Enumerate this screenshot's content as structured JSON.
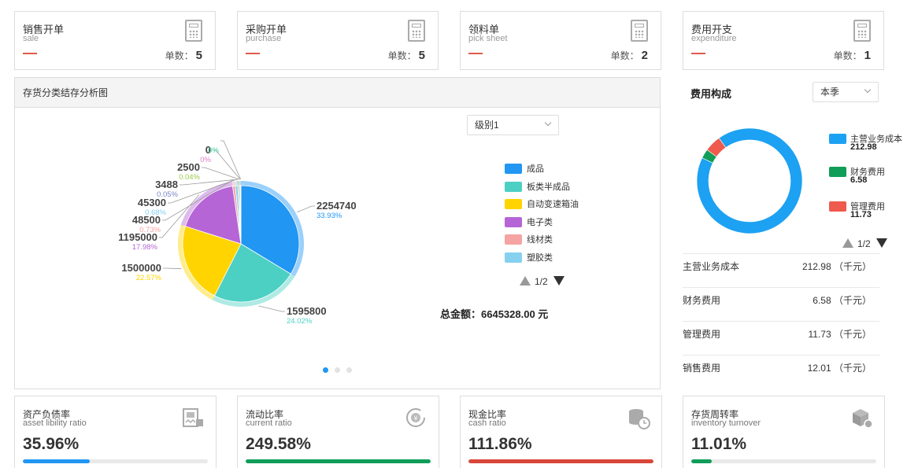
{
  "stat_cards": [
    {
      "title": "销售开单",
      "subtitle": "sale",
      "count_label": "单数：",
      "count": "5"
    },
    {
      "title": "采购开单",
      "subtitle": "purchase",
      "count_label": "单数：",
      "count": "5"
    },
    {
      "title": "领料单",
      "subtitle": "pick sheet",
      "count_label": "单数：",
      "count": "2"
    },
    {
      "title": "费用开支",
      "subtitle": "expenditure",
      "count_label": "单数：",
      "count": "1"
    }
  ],
  "inventory_panel": {
    "title": "存货分类结存分析图",
    "level_select": "级别1",
    "legend": [
      "成品",
      "板类半成品",
      "自动变速箱油",
      "电子类",
      "线材类",
      "塑胶类"
    ],
    "pager": "1/2",
    "total": "总金额：6645328.00 元",
    "page_dots": 3,
    "active_dot": 0
  },
  "chart_data": {
    "type": "pie",
    "title": "存货分类结存分析图",
    "slices": [
      {
        "label": "成品",
        "value": 2254740,
        "percent": "33.93%",
        "color": "#2196f3"
      },
      {
        "label": "板类半成品",
        "value": 1595800,
        "percent": "24.02%",
        "color": "#4dd0c4"
      },
      {
        "label": "自动变速箱油",
        "value": 1500000,
        "percent": "22.57%",
        "color": "#ffd400"
      },
      {
        "label": "电子类",
        "value": 1195000,
        "percent": "17.98%",
        "color": "#b565d6"
      },
      {
        "label": "线材类",
        "value": 48500,
        "percent": "0.73%",
        "color": "#f5a3a3"
      },
      {
        "label": "塑胶类",
        "value": 45300,
        "percent": "0.68%",
        "color": "#86d0f0"
      },
      {
        "label": "",
        "value": 3488,
        "percent": "0.05%",
        "color": "#7a86c8"
      },
      {
        "label": "",
        "value": 2500,
        "percent": "0.04%",
        "color": "#9ccc4e"
      },
      {
        "label": "",
        "value": 0,
        "percent": "0%",
        "color": "#e07bc8"
      },
      {
        "label": "",
        "value": 0,
        "percent": "0%",
        "color": "#42d4a0"
      }
    ]
  },
  "cost_panel": {
    "title": "费用构成",
    "period_select": "本季",
    "pager": "1/2",
    "donut": [
      {
        "name": "主营业务成本",
        "value": 212.98,
        "color": "#1da1f2"
      },
      {
        "name": "财务费用",
        "value": 6.58,
        "color": "#0f9d58"
      },
      {
        "name": "管理费用",
        "value": 11.73,
        "color": "#ee5a4d"
      }
    ],
    "legend_values": [
      "212.98",
      "6.58",
      "11.73"
    ],
    "rows": [
      {
        "name": "主营业务成本",
        "value": "212.98 （千元）"
      },
      {
        "name": "财务费用",
        "value": "6.58 （千元）"
      },
      {
        "name": "管理费用",
        "value": "11.73 （千元）"
      },
      {
        "name": "销售费用",
        "value": "12.01 （千元）"
      }
    ]
  },
  "ratio_cards": [
    {
      "title": "资产负债率",
      "subtitle": "asset libility ratio",
      "value": "35.96%",
      "fraction": 0.3596,
      "color": "#2196f3",
      "icon": "report-icon"
    },
    {
      "title": "流动比率",
      "subtitle": "current ratio",
      "value": "249.58%",
      "fraction": 1.0,
      "color": "#0f9d58",
      "icon": "currency-cycle-icon"
    },
    {
      "title": "现金比率",
      "subtitle": "cash ratio",
      "value": "111.86%",
      "fraction": 1.0,
      "color": "#d9473b",
      "icon": "coins-clock-icon"
    },
    {
      "title": "存货周转率",
      "subtitle": "inventory turnover",
      "value": "11.01%",
      "fraction": 0.1101,
      "color": "#0f9d58",
      "icon": "box-icon"
    }
  ]
}
